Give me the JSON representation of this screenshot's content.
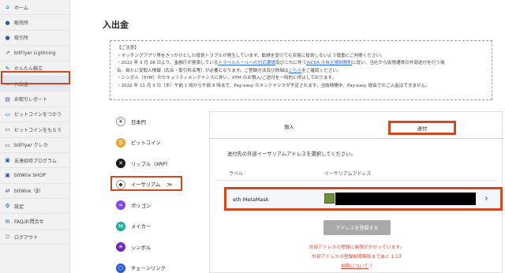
{
  "sidebar": {
    "items": [
      {
        "label": "ホーム",
        "icon": "home-icon",
        "glyph": "⌂"
      },
      {
        "label": "販売所",
        "icon": "shop-icon",
        "glyph": "●"
      },
      {
        "label": "取引所",
        "icon": "exchange-icon",
        "glyph": "●"
      },
      {
        "label": "bitFlyer Lightning",
        "icon": "lightning-icon",
        "glyph": "↗"
      },
      {
        "label": "かんたん積立",
        "icon": "savings-icon",
        "glyph": "✎"
      },
      {
        "label": "入出金",
        "icon": "wallet-icon",
        "glyph": "▭"
      },
      {
        "label": "お取引レポート",
        "icon": "report-icon",
        "glyph": "▤"
      },
      {
        "label": "ビットコインをつかう",
        "icon": "use-bitcoin-icon",
        "glyph": "▭"
      },
      {
        "label": "ビットコインをもらう",
        "icon": "earn-bitcoin-icon",
        "glyph": "▭"
      },
      {
        "label": "bitFlyer クレカ",
        "icon": "credit-card-icon",
        "glyph": "▭"
      },
      {
        "label": "友達招待プログラム",
        "icon": "invite-icon",
        "glyph": "▣"
      },
      {
        "label": "bitWire SHOP",
        "icon": "cart-icon",
        "glyph": "▣"
      },
      {
        "label": "bitWire（β）",
        "icon": "bitwire-icon",
        "glyph": "⇄"
      },
      {
        "label": "設定",
        "icon": "gear-icon",
        "glyph": "⚙"
      },
      {
        "label": "FAQ/お問合せ",
        "icon": "help-icon",
        "glyph": "✉"
      },
      {
        "label": "ログアウト",
        "icon": "logout-icon",
        "glyph": "⎋"
      }
    ]
  },
  "page": {
    "title": "入出金"
  },
  "notice": {
    "heading": "【ご注意】",
    "line1": "・マッチングアプリ等をきっかけとした投資トラブルが発生しています。勧誘を受けても安易に投資しないよう慎重にご判断ください。",
    "line2a": "・2022 年 3 月 28 日より、金融庁が発表している",
    "line2_link1": "トラベルルールへの対応要請",
    "line2b": "及びこれに伴う",
    "line2_link2": "JVCEA の自主規制規則",
    "line2c": "に従い、当社から仮想通貨の外部送付を行う場",
    "line3a": "合、新たに受取人情報（氏名・取引所名等）が必要となります。ご登録方法及び詳細は",
    "line3_link": "こちら",
    "line3b": "をご確認ください。",
    "line4": "・シンボル（XYM）のセキュリティメンテナンスに伴い、XYM のお預入/ご送付を一時的に停止しております。",
    "line5": "・2022 年 11 月 3 日（木）午前 1 時から午前 8 時まで、Pay-easy のメンテナンスが予定されます。当該時間中、Pay-easy 経由でのご入金はできません。"
  },
  "currencies": [
    {
      "label": "日本円",
      "icon": "yen-icon",
      "glyph": "¥",
      "color": "#ffffff",
      "fg": "#333333"
    },
    {
      "label": "ビットコイン",
      "icon": "bitcoin-icon",
      "glyph": "₿",
      "color": "#f3a028",
      "fg": "#ffffff"
    },
    {
      "label": "リップル（XRP）",
      "icon": "xrp-icon",
      "glyph": "✕",
      "color": "#1a1a1a",
      "fg": "#ffffff"
    },
    {
      "label": "イーサリアム",
      "icon": "ethereum-icon",
      "glyph": "◆",
      "color": "#ffffff",
      "fg": "#333333",
      "chev": "≫"
    },
    {
      "label": "ポリゴン",
      "icon": "polygon-icon",
      "glyph": "∞",
      "color": "#8247e5",
      "fg": "#ffffff"
    },
    {
      "label": "メイカー",
      "icon": "maker-icon",
      "glyph": "M",
      "color": "#1aab9b",
      "fg": "#ffffff"
    },
    {
      "label": "シンボル",
      "icon": "symbol-icon",
      "glyph": "✳",
      "color": "#6b2bb8",
      "fg": "#ffffff"
    },
    {
      "label": "チェーンリンク",
      "icon": "chainlink-icon",
      "glyph": "⬡",
      "color": "#2a5ada",
      "fg": "#ffffff"
    }
  ],
  "tabs": {
    "deposit": "預入",
    "send": "送付"
  },
  "panel": {
    "instruction": "送付先の外部イーサリアムアドレスを選択してください。",
    "col_label": "ラベル",
    "col_address": "イーサリアムアドレス",
    "address_label": "eth MetaMask",
    "register_button": "アドレスを登録する",
    "warn1": "外部アドレスの登録に制限がかかっています。",
    "warn2": "外部アドレスの登録制限解除まであと 1:13",
    "warn3": "制限について"
  },
  "colors": {
    "highlight": "#d2481e",
    "link": "#2a6bd1",
    "warning": "#d04a3a"
  }
}
